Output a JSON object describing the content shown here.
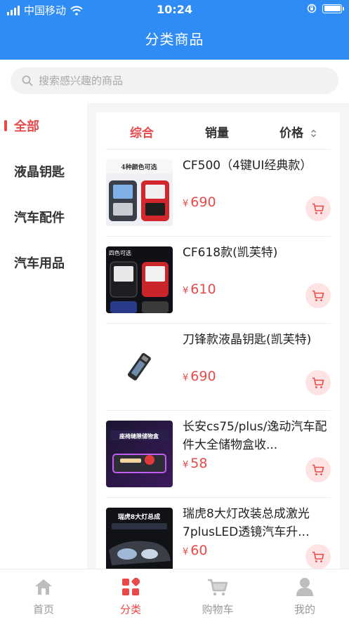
{
  "status_bar": {
    "carrier": "中国移动",
    "time": "10:24"
  },
  "header": {
    "title": "分类商品"
  },
  "search": {
    "placeholder": "搜索感兴趣的商品"
  },
  "sidebar": {
    "items": [
      {
        "label": "全部",
        "active": true
      },
      {
        "label": "液晶钥匙",
        "active": false
      },
      {
        "label": "汽车配件",
        "active": false
      },
      {
        "label": "汽车用品",
        "active": false
      }
    ]
  },
  "sort": {
    "items": [
      {
        "label": "综合",
        "active": true
      },
      {
        "label": "销量"
      },
      {
        "label": "价格"
      }
    ]
  },
  "products": [
    {
      "name": "CF500（4键UI经典款）",
      "currency": "¥",
      "price": "690",
      "image_text": "4种颜色可选"
    },
    {
      "name": "CF618款(凯芙特)",
      "currency": "¥",
      "price": "610",
      "image_text": "四色可选"
    },
    {
      "name": "刀锋款液晶钥匙(凯芙特)",
      "currency": "¥",
      "price": "690",
      "image_text": ""
    },
    {
      "name": "长安cs75/plus/逸动汽车配件大全储物盒收...",
      "currency": "¥",
      "price": "58",
      "image_text": "座椅缝隙储物盒"
    },
    {
      "name": "瑞虎8大灯改装总成激光7plusLED透镜汽车升...",
      "currency": "¥",
      "price": "60",
      "image_text": "瑞虎8大灯总成"
    }
  ],
  "tabbar": {
    "items": [
      {
        "label": "首页",
        "icon": "home-icon"
      },
      {
        "label": "分类",
        "icon": "category-icon",
        "active": true
      },
      {
        "label": "购物车",
        "icon": "cart-icon"
      },
      {
        "label": "我的",
        "icon": "user-icon"
      }
    ]
  },
  "colors": {
    "header": "#2f8cf5",
    "accent": "#e84a4a",
    "cart_bg": "#fde3e3"
  }
}
